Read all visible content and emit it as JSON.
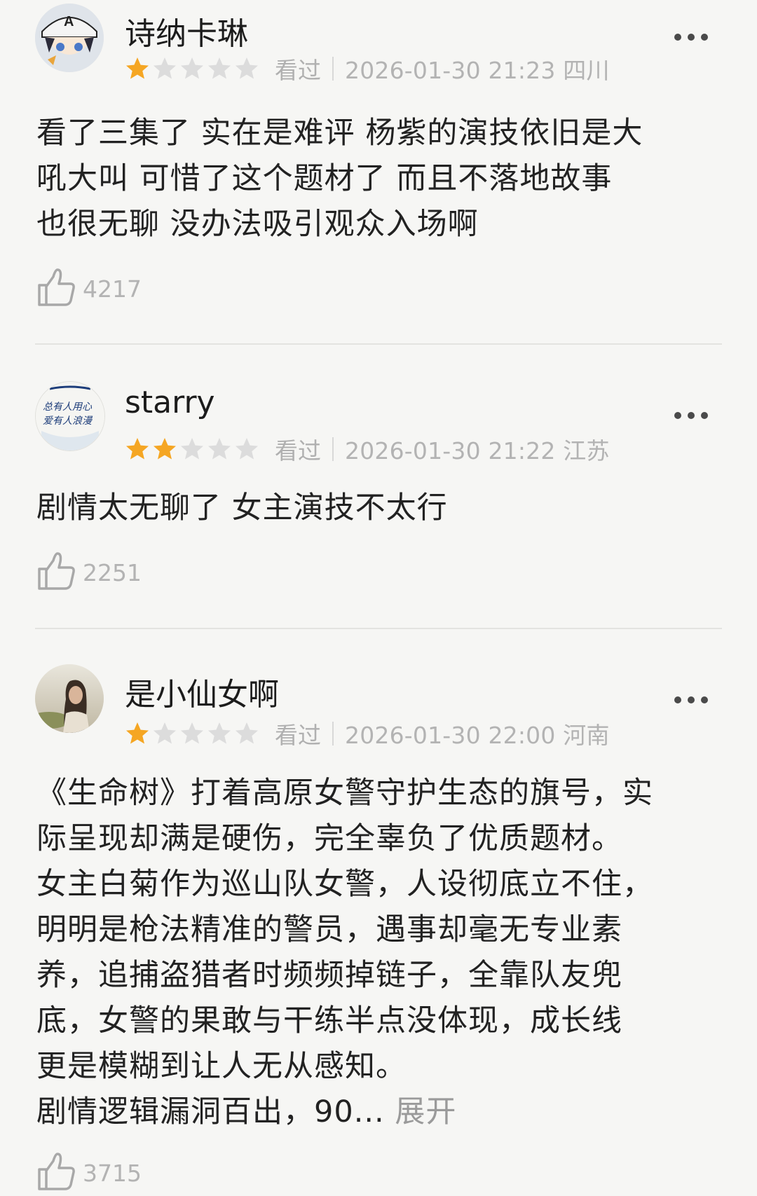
{
  "reviews": [
    {
      "user": "诗纳卡琳",
      "rating": 1,
      "seen_label": "看过",
      "datetime_location": "2026-01-30 21:23 四川",
      "content": "看了三集了 实在是难评 杨紫的演技依旧是大\n吼大叫 可惜了这个题材了 而且不落地故事\n也很无聊 没办法吸引观众入场啊",
      "likes": "4217",
      "avatar": "anime-avatar-icon"
    },
    {
      "user": "starry",
      "rating": 2,
      "seen_label": "看过",
      "datetime_location": "2026-01-30 21:22 江苏",
      "content": "剧情太无聊了 女主演技不太行",
      "likes": "2251",
      "avatar": "handwriting-avatar-icon",
      "avatar_text": "总有人用心\n爱有人浪漫"
    },
    {
      "user": "是小仙女啊",
      "rating": 1,
      "seen_label": "看过",
      "datetime_location": "2026-01-30 22:00 河南",
      "content": "《生命树》打着高原女警守护生态的旗号，实\n际呈现却满是硬伤，完全辜负了优质题材。\n女主白菊作为巡山队女警，人设彻底立不住，\n明明是枪法精准的警员，遇事却毫无专业素\n养，追捕盗猎者时频频掉链子，全靠队友兜\n底，女警的果敢与干练半点没体现，成长线\n更是模糊到让人无从感知。\n剧情逻辑漏洞百出，90... ",
      "expand_label": "展开",
      "likes": "3715",
      "avatar": "photo-avatar-icon"
    }
  ],
  "colors": {
    "star_filled": "#f5a623",
    "star_empty": "#dcdcdc"
  },
  "icons": {
    "like": "thumbs-up-icon",
    "more": "more-dots-icon",
    "star": "star-icon"
  }
}
